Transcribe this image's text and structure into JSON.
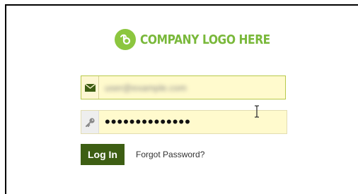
{
  "logo": {
    "text": "COMPANY LOGO HERE",
    "icon": "leaf-badge-icon",
    "color": "#79b83a"
  },
  "email_field": {
    "icon": "envelope-icon",
    "value": "user@example.com"
  },
  "password_field": {
    "icon": "key-icon",
    "value": "••••••••••••••"
  },
  "login_button": {
    "label": "Log In",
    "color": "#3d5e13"
  },
  "forgot_password": {
    "label": "Forgot Password?"
  },
  "pointer": {
    "icon": "text-cursor-icon"
  }
}
